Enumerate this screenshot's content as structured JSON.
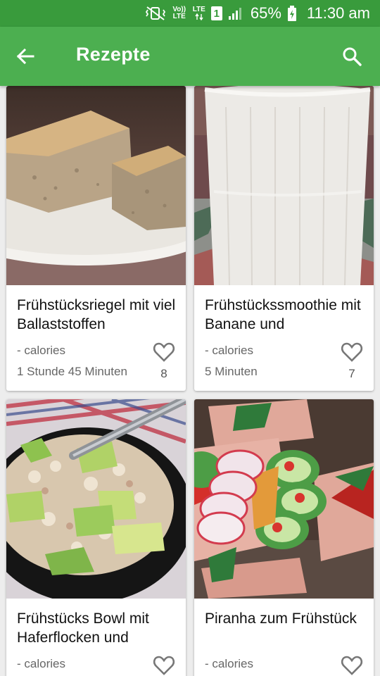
{
  "status_bar": {
    "volte_label": "Vo)) LTE",
    "network_label": "LTE",
    "sim_slot": "1",
    "battery_percent": "65%",
    "time": "11:30 am"
  },
  "app_bar": {
    "title": "Rezepte",
    "back_icon": "arrow-back-icon",
    "search_icon": "search-icon"
  },
  "colors": {
    "status_bar": "#399b3c",
    "app_bar": "#4caf50",
    "background": "#ededed",
    "card": "#ffffff"
  },
  "recipes": [
    {
      "title": "Frühstücksriegel mit viel Ballaststoffen",
      "calories": "- calories",
      "time": "1 Stunde 45 Minuten",
      "likes": "8"
    },
    {
      "title": "Frühstückssmoothie mit Banane und",
      "calories": "- calories",
      "time": "5 Minuten",
      "likes": "7"
    },
    {
      "title": "Frühstücks Bowl mit Haferflocken und",
      "calories": "- calories",
      "time": "",
      "likes": ""
    },
    {
      "title": "Piranha zum Frühstück",
      "calories": "- calories",
      "time": "",
      "likes": ""
    }
  ]
}
